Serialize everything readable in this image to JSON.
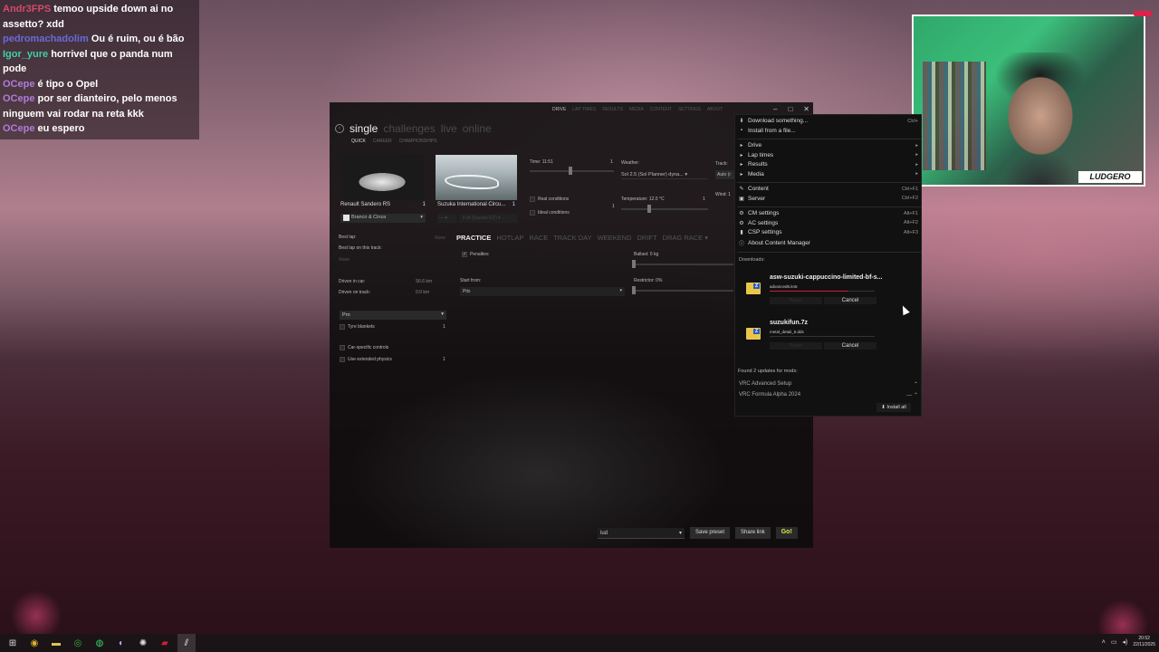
{
  "chat": {
    "messages": [
      {
        "user": "Andr3FPS",
        "user_color": "#d44a6a",
        "text": "temoo upside down ai no assetto? xdd"
      },
      {
        "user": "pedromachadolim",
        "user_color": "#6a6adb",
        "text": "Ou é ruim, ou é bão"
      },
      {
        "user": "Igor_yure",
        "user_color": "#3fd0a8",
        "text": "horrivel que o panda num pode"
      },
      {
        "user": "OCepe",
        "user_color": "#b07bd9",
        "text": "é tipo o Opel"
      },
      {
        "user": "OCepe",
        "user_color": "#b07bd9",
        "text": "por ser dianteiro, pelo menos ninguem vai rodar na reta kkk"
      },
      {
        "user": "OCepe",
        "user_color": "#b07bd9",
        "text": "eu espero"
      }
    ]
  },
  "webcam": {
    "tag": "LUDGERO"
  },
  "cm": {
    "top_links": [
      "DRIVE",
      "LAP TIMES",
      "RESULTS",
      "MEDIA",
      "CONTENT",
      "SETTINGS",
      "ABOUT"
    ],
    "active_top_link": "DRIVE",
    "mode_tabs": [
      "single",
      "challenges",
      "live",
      "online"
    ],
    "sub_tabs": [
      "QUICK",
      "CAREER",
      "CHAMPIONSHIPS"
    ],
    "car": {
      "name": "Renault Sandero RS",
      "count": "1",
      "skin": "Branco & Cinza"
    },
    "track": {
      "name": "Suzuka International Circu...",
      "count": "1",
      "layout": "—",
      "layout2": "Full (Suzuka GT)"
    },
    "time": {
      "label": "Time: 11:51",
      "count": "1"
    },
    "weather": {
      "label": "Weather:",
      "value": "Sol 2.5 (Sol Planner) dyna..."
    },
    "track_state": {
      "label": "Track:",
      "value": "Auto (r"
    },
    "temperature": {
      "label": "Temperature: 12.0 °C",
      "count": "1"
    },
    "wind": {
      "label": "Wind: 1"
    },
    "real_conditions": "Real conditions",
    "ideal_conditions": "Ideal conditions",
    "ideal_count": "1",
    "best_lap": "Best lap:",
    "best_lap_none": "None",
    "best_lap_track": "Best lap on this track:",
    "best_lap_track_value": "None",
    "driven_car": {
      "label": "Driven in car:",
      "value": "56.6 km"
    },
    "driven_track": {
      "label": "Driven on track:",
      "value": "0.0 km"
    },
    "type_tabs": [
      "PRACTICE",
      "HOTLAP",
      "RACE",
      "TRACK DAY",
      "WEEKEND",
      "DRIFT",
      "DRAG RACE ▾"
    ],
    "active_type_tab": "PRACTICE",
    "penalties": "Penalties",
    "ballast": "Ballast: 0 kg",
    "start_from": {
      "label": "Start from:",
      "value": "Pits"
    },
    "restrictor": "Restrictor: 0%",
    "assists": {
      "value": "Pro"
    },
    "tyre_blankets": "Tyre blankets",
    "tyre_count": "1",
    "car_controls": "Car-specific controls",
    "extended_physics": "Use extended physics",
    "physics_count": "1",
    "preset": "lud",
    "save_preset": "Save preset",
    "share_link": "Share link",
    "go": "Go!"
  },
  "menu": {
    "items1": [
      {
        "icon": "download-icon",
        "glyph": "⬇",
        "label": "Download something...",
        "key": "Ctrl+"
      },
      {
        "icon": "file-icon",
        "glyph": "▪",
        "label": "Install from a file...",
        "key": ""
      }
    ],
    "items2": [
      {
        "label": "Drive",
        "key": "▸"
      },
      {
        "label": "Lap times",
        "key": "▸"
      },
      {
        "label": "Results",
        "key": "▸"
      },
      {
        "label": "Media",
        "key": "▸"
      }
    ],
    "items3": [
      {
        "label": "Content",
        "key": "Ctrl+F1"
      },
      {
        "label": "Server",
        "key": "Ctrl+F2"
      }
    ],
    "items4": [
      {
        "label": "CM settings",
        "key": "Alt+F1"
      },
      {
        "label": "AC settings",
        "key": "Alt+F2"
      },
      {
        "label": "CSP settings",
        "key": "Alt+F3"
      },
      {
        "label": "About Content Manager",
        "key": ""
      }
    ],
    "downloads_title": "Downloads:",
    "downloads": [
      {
        "name": "asw-suzuki-cappuccino-limited-bf-s...",
        "sub": "advanced6.kn5",
        "pause": "Pause",
        "cancel": "Cancel",
        "progress": 0.75
      },
      {
        "name": "suzukifun.7z",
        "sub": "metal_detail_5.dds",
        "pause": "Pause",
        "cancel": "Cancel",
        "progress": 0.0
      }
    ],
    "updates_title": "Found 2 updates for mods:",
    "updates": [
      {
        "name": "VRC Advanced Setup",
        "extra": ""
      },
      {
        "name": "VRC Formula Alpha 2024",
        "extra": "—"
      }
    ],
    "install_all": "⬇ Install all"
  },
  "taskbar": {
    "icons": [
      "windows-start-icon",
      "chrome-icon",
      "file-explorer-icon",
      "xbox-icon",
      "whatsapp-icon",
      "discord-icon",
      "settings-icon",
      "app-icon",
      "content-manager-icon"
    ],
    "time": "20:52",
    "date": "22/11/2025"
  }
}
